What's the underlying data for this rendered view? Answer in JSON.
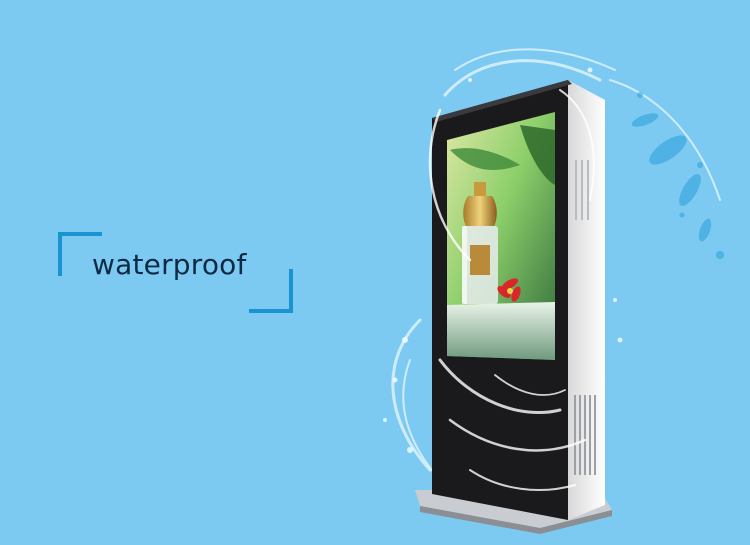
{
  "headline": {
    "text": "waterproof"
  },
  "colors": {
    "background": "#7ccaf2",
    "accent": "#1a93d1",
    "kiosk_body": "#1a1a1c",
    "kiosk_side": "#f2f2f2"
  },
  "product_image": {
    "icon": "perfume-bottle-icon"
  }
}
